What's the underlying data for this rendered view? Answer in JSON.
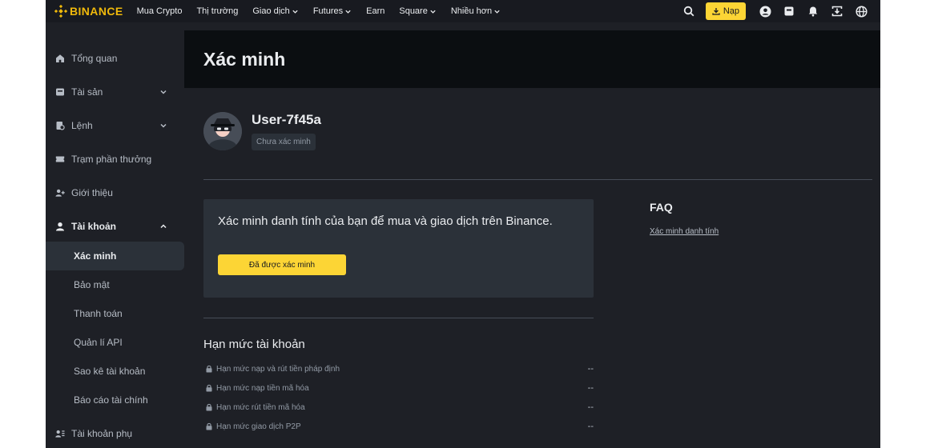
{
  "brand": {
    "name": "BINANCE",
    "color": "#f0b90b"
  },
  "nav": [
    {
      "label": "Mua Crypto",
      "has_dropdown": false
    },
    {
      "label": "Thị trường",
      "has_dropdown": false
    },
    {
      "label": "Giao dịch",
      "has_dropdown": true
    },
    {
      "label": "Futures",
      "has_dropdown": true
    },
    {
      "label": "Earn",
      "has_dropdown": false
    },
    {
      "label": "Square",
      "has_dropdown": true
    },
    {
      "label": "Nhiều hơn",
      "has_dropdown": true
    }
  ],
  "topbar": {
    "deposit_label": "Nạp",
    "icons": [
      "search-icon",
      "deposit-icon",
      "user-icon",
      "wallet-icon",
      "notification-bell-icon",
      "download-icon",
      "language-globe-icon"
    ]
  },
  "sidebar": {
    "items": [
      {
        "label": "Tổng quan",
        "icon": "home-icon"
      },
      {
        "label": "Tài sản",
        "icon": "wallet-icon",
        "expandable": true
      },
      {
        "label": "Lệnh",
        "icon": "orders-icon",
        "expandable": true
      },
      {
        "label": "Trạm phần thưởng",
        "icon": "ticket-icon"
      },
      {
        "label": "Giới thiệu",
        "icon": "add-user-icon"
      },
      {
        "label": "Tài khoản",
        "icon": "user-icon",
        "expanded": true
      },
      {
        "label": "Tài khoản phụ",
        "icon": "sub-account-icon"
      }
    ],
    "account_sub": [
      {
        "label": "Xác minh",
        "active": true
      },
      {
        "label": "Bảo mật"
      },
      {
        "label": "Thanh toán"
      },
      {
        "label": "Quản lí API"
      },
      {
        "label": "Sao kê tài khoản"
      },
      {
        "label": "Báo cáo tài chính"
      }
    ]
  },
  "page": {
    "title": "Xác minh"
  },
  "profile": {
    "username": "User-7f45a",
    "status": "Chưa xác minh"
  },
  "verify_card": {
    "text": "Xác minh danh tính của bạn để mua và giao dịch trên Binance.",
    "button_label": "Đã được xác minh"
  },
  "faq": {
    "title": "FAQ",
    "link": "Xác minh danh tính"
  },
  "limits": {
    "title": "Hạn mức tài khoản",
    "rows": [
      {
        "label": "Hạn mức nạp và rút tiền pháp định",
        "value": "--"
      },
      {
        "label": "Hạn mức nạp tiền mã hóa",
        "value": "--"
      },
      {
        "label": "Hạn mức rút tiền mã hóa",
        "value": "--"
      },
      {
        "label": "Hạn mức giao dịch P2P",
        "value": "--"
      }
    ]
  },
  "colors": {
    "accent": "#fcd535",
    "background": "#1e2026",
    "header": "#0b0e11",
    "card": "#2b3139"
  }
}
